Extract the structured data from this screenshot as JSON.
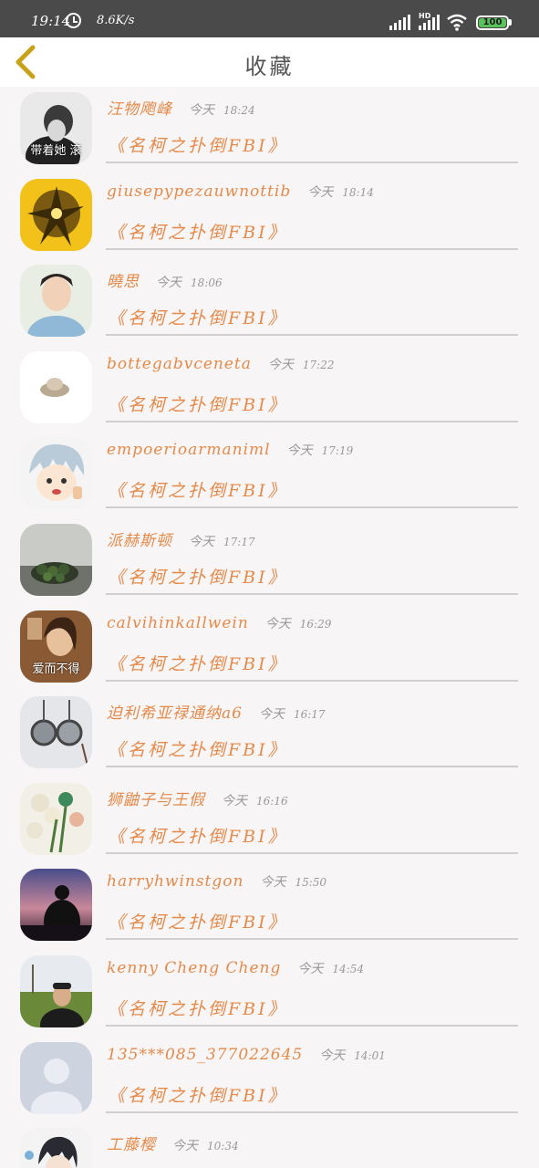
{
  "status_bar": {
    "time": "19:14",
    "net_speed": "8.6K/s",
    "battery": "100",
    "hd": "HD"
  },
  "header": {
    "title": "收藏"
  },
  "items": [
    {
      "user": "汪物飑峰",
      "day": "今天",
      "time": "18:24",
      "book": "《名柯之扑倒FBI》",
      "avatar_caption": "带着她 滚"
    },
    {
      "user": "giusepypezauwnottib",
      "day": "今天",
      "time": "18:14",
      "book": "《名柯之扑倒FBI》"
    },
    {
      "user": "曉思",
      "day": "今天",
      "time": "18:06",
      "book": "《名柯之扑倒FBI》"
    },
    {
      "user": "bottegabvceneta",
      "day": "今天",
      "time": "17:22",
      "book": "《名柯之扑倒FBI》"
    },
    {
      "user": "empoerioarmaniml",
      "day": "今天",
      "time": "17:19",
      "book": "《名柯之扑倒FBI》"
    },
    {
      "user": "派赫斯顿",
      "day": "今天",
      "time": "17:17",
      "book": "《名柯之扑倒FBI》"
    },
    {
      "user": "calvihinkallwein",
      "day": "今天",
      "time": "16:29",
      "book": "《名柯之扑倒FBI》",
      "avatar_caption": "爱而不得"
    },
    {
      "user": "迫利希亚禄通纳a6",
      "day": "今天",
      "time": "16:17",
      "book": "《名柯之扑倒FBI》"
    },
    {
      "user": "狮鼬子与王假",
      "day": "今天",
      "time": "16:16",
      "book": "《名柯之扑倒FBI》"
    },
    {
      "user": "harryhwinstgon",
      "day": "今天",
      "time": "15:50",
      "book": "《名柯之扑倒FBI》"
    },
    {
      "user": "kenny Cheng Cheng",
      "day": "今天",
      "time": "14:54",
      "book": "《名柯之扑倒FBI》"
    },
    {
      "user": "135***085_377022645",
      "day": "今天",
      "time": "14:01",
      "book": "《名柯之扑倒FBI》"
    },
    {
      "user": "工藤樱",
      "day": "今天",
      "time": "10:34",
      "book": ""
    }
  ],
  "icons": {
    "back": "chevron-left-icon",
    "status": [
      "alarm-icon",
      "signal-icon",
      "wifi-icon",
      "battery-icon"
    ]
  },
  "colors": {
    "accent": "#e58a4a",
    "back_icon": "#c9a21a",
    "status_bar": "#4a4a4a",
    "battery_fill": "#58c35b"
  }
}
